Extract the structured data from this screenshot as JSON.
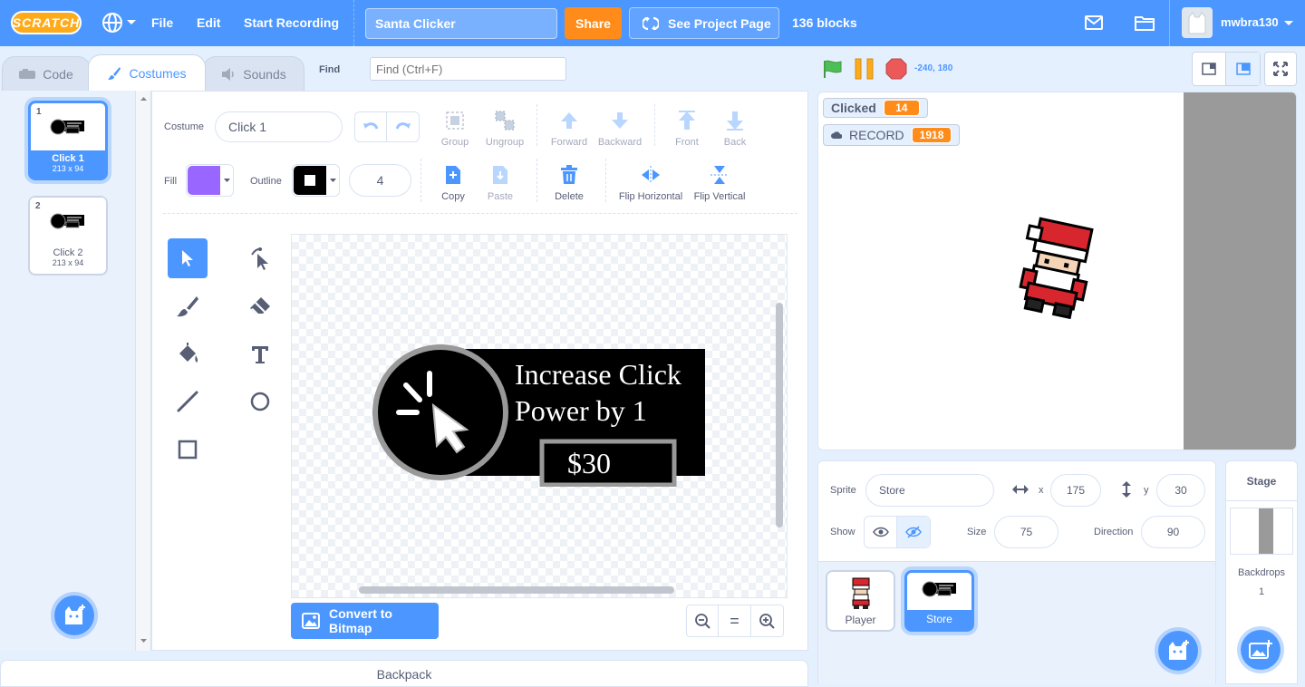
{
  "menu": {
    "logo": "SCRATCH",
    "file": "File",
    "edit": "Edit",
    "start_recording": "Start Recording",
    "project_title": "Santa Clicker",
    "share": "Share",
    "see_project_page": "See Project Page",
    "blocks_count": "136 blocks",
    "username": "mwbra130"
  },
  "tabs": {
    "code": "Code",
    "costumes": "Costumes",
    "sounds": "Sounds"
  },
  "find": {
    "label": "Find",
    "placeholder": "Find (Ctrl+F)"
  },
  "costumes": [
    {
      "num": "1",
      "name": "Click 1",
      "size": "213 x 94"
    },
    {
      "num": "2",
      "name": "Click 2",
      "size": "213 x 94"
    }
  ],
  "editor": {
    "costume_label": "Costume",
    "costume_name": "Click 1",
    "fill_label": "Fill",
    "outline_label": "Outline",
    "outline_width": "4",
    "fill_color": "#9966ff",
    "group": "Group",
    "ungroup": "Ungroup",
    "forward": "Forward",
    "backward": "Backward",
    "front": "Front",
    "back": "Back",
    "copy": "Copy",
    "paste": "Paste",
    "delete": "Delete",
    "flip_horizontal": "Flip Horizontal",
    "flip_vertical": "Flip Vertical",
    "convert": "Convert to Bitmap",
    "zoom_reset": "="
  },
  "artwork": {
    "line1": "Increase Click",
    "line2": "Power by 1",
    "price": "$30"
  },
  "stage_controls": {
    "coords": "-240, 180"
  },
  "monitors": [
    {
      "label": "Clicked",
      "value": "14"
    },
    {
      "label": "RECORD",
      "value": "1918"
    }
  ],
  "sprite_info": {
    "sprite_label": "Sprite",
    "sprite_name": "Store",
    "x_label": "x",
    "x": "175",
    "y_label": "y",
    "y": "30",
    "show_label": "Show",
    "size_label": "Size",
    "size": "75",
    "direction_label": "Direction",
    "direction": "90"
  },
  "sprites": [
    {
      "name": "Player"
    },
    {
      "name": "Store"
    }
  ],
  "stage_panel": {
    "title": "Stage",
    "backdrops_label": "Backdrops",
    "backdrops_count": "1"
  },
  "backpack": "Backpack",
  "colors": {
    "accent": "#4c97ff",
    "orange": "#ff8c1a",
    "menu": "#4c97ff"
  }
}
